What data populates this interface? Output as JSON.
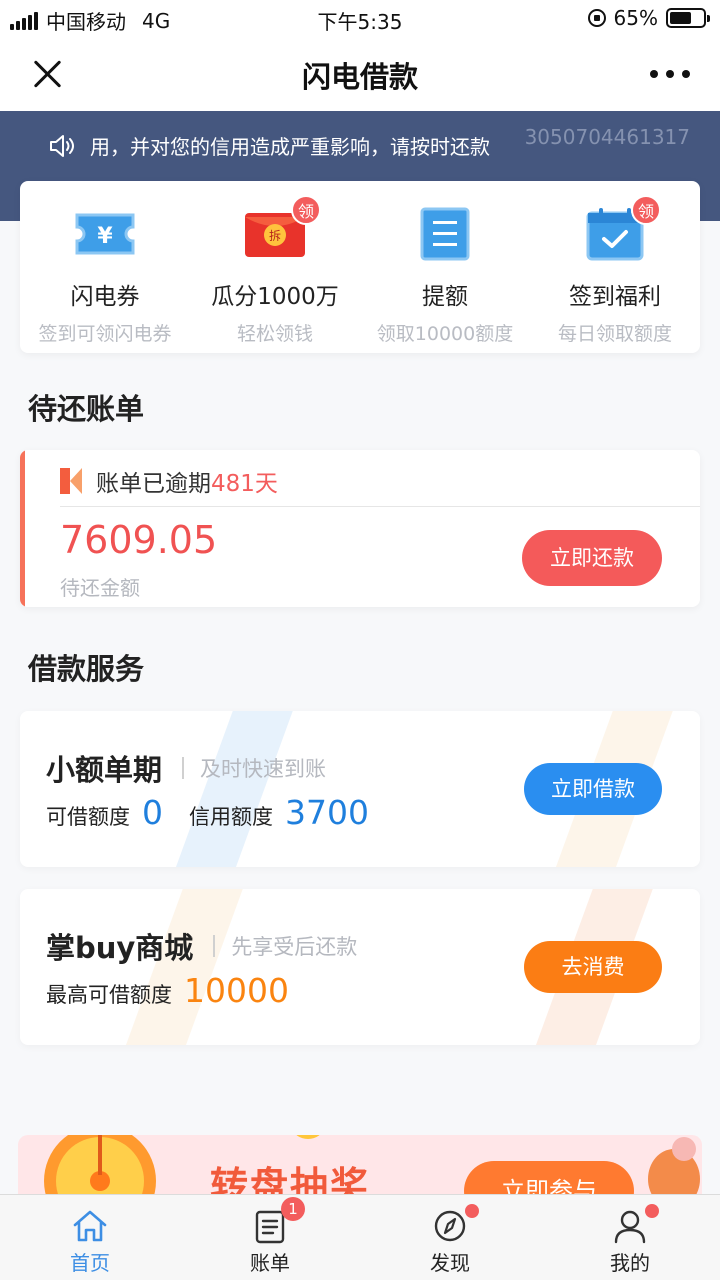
{
  "status_bar": {
    "carrier": "中国移动",
    "network": "4G",
    "time": "下午5:35",
    "battery_text": "65%",
    "battery_level": 0.65
  },
  "navbar": {
    "title": "闪电借款"
  },
  "notice": {
    "text": "用，并对您的信用造成严重影响，请按时还款",
    "id": "3050704461317"
  },
  "quick_entries": [
    {
      "title": "闪电券",
      "subtitle": "签到可领闪电券",
      "icon": "ticket-yen-icon",
      "badge": ""
    },
    {
      "title": "瓜分1000万",
      "subtitle": "轻松领钱",
      "icon": "red-envelope-icon",
      "badge": "领"
    },
    {
      "title": "提额",
      "subtitle": "领取10000额度",
      "icon": "document-icon",
      "badge": ""
    },
    {
      "title": "签到福利",
      "subtitle": "每日领取额度",
      "icon": "calendar-check-icon",
      "badge": "领"
    }
  ],
  "bills_section": {
    "title": "待还账单"
  },
  "bill": {
    "status_prefix": "账单已逾期",
    "overdue_days": "481天",
    "amount": "7609.05",
    "amount_label": "待还金额",
    "button": "立即还款"
  },
  "services_section": {
    "title": "借款服务"
  },
  "services": [
    {
      "title": "小额单期",
      "slogan": "及时快速到账",
      "quota1_label": "可借额度",
      "quota1_value": "0",
      "quota2_label": "信用额度",
      "quota2_value": "3700",
      "button": "立即借款",
      "button_color": "#2a8ef0"
    },
    {
      "title": "掌buy商城",
      "slogan": "先享受后还款",
      "quota1_label": "最高可借额度",
      "quota1_value": "10000",
      "button": "去消费",
      "button_color": "#fb7d14"
    }
  ],
  "banner": {
    "text": "转盘抽奖",
    "button": "立即参与"
  },
  "tabs": [
    {
      "label": "首页",
      "icon": "home-icon",
      "active": true,
      "badge": ""
    },
    {
      "label": "账单",
      "icon": "bill-icon",
      "active": false,
      "badge": "1"
    },
    {
      "label": "发现",
      "icon": "compass-icon",
      "active": false,
      "badge": "dot"
    },
    {
      "label": "我的",
      "icon": "user-icon",
      "active": false,
      "badge": "dot"
    }
  ],
  "colors": {
    "accent_red": "#f45a5a",
    "accent_blue": "#1f7fdd",
    "accent_orange": "#fa8410",
    "header_blue": "#45577f"
  }
}
